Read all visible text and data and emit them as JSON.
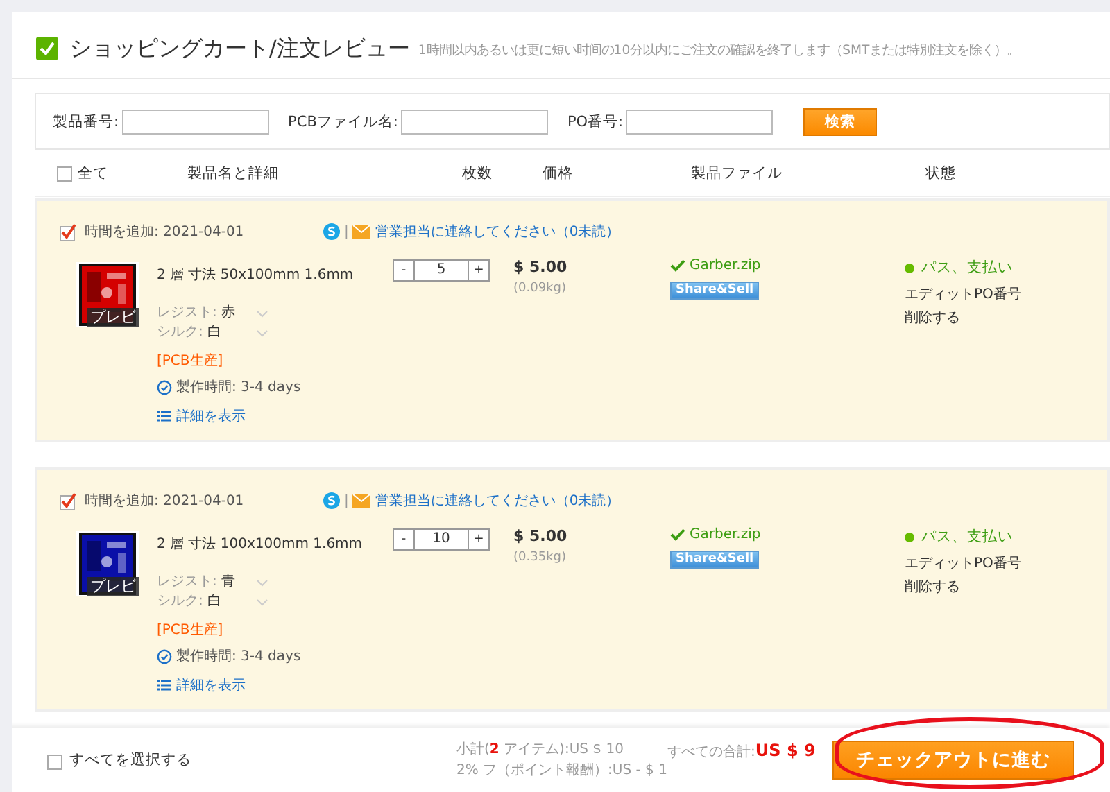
{
  "header": {
    "title": "ショッピングカート/注文レビュー",
    "note": "1時間以内あるいは更に短い时间の10分以内にご注文の確認を終了します（SMTまたは特別注文を除く）。"
  },
  "search": {
    "fields": [
      {
        "label": "製品番号:"
      },
      {
        "label": "PCBファイル名:"
      },
      {
        "label": "PO番号:"
      }
    ],
    "button": "検索"
  },
  "table": {
    "select_all": {
      "label": "全て",
      "checked": false
    },
    "columns": [
      "製品名と詳細",
      "枚数",
      "価格",
      "製品ファイル",
      "状態"
    ]
  },
  "items": [
    {
      "checked": true,
      "added": "時間を追加: 2021-04-01",
      "separator": "|",
      "contact": "営業担当に連絡してください（0未読）",
      "thumbnail": {
        "kind": "picture",
        "color": "#d40000"
      },
      "preview": "プレビ",
      "spec": "2 層 寸法 50x100mm 1.6mm",
      "options": [
        {
          "label": "レジスト:",
          "value": "赤"
        },
        {
          "label": "シルク:",
          "value": "白"
        }
      ],
      "tag": "[PCB生産]",
      "lead_time": "製作時間: 3-4 days",
      "details": "詳細を表示",
      "minus": "-",
      "quantity": "5",
      "plus": "+",
      "price": "$ 5.00",
      "weight": "(0.09kg)",
      "file": "Garber.zip",
      "share": "Share&Sell",
      "status": "パス、支払い",
      "actions": [
        "エディットPO番号",
        "削除する"
      ]
    },
    {
      "checked": true,
      "added": "時間を追加: 2021-04-01",
      "separator": "|",
      "contact": "営業担当に連絡してください（0未読）",
      "thumbnail": {
        "kind": "picture",
        "color": "#0a0fa8"
      },
      "preview": "プレビ",
      "spec": "2 層 寸法 100x100mm 1.6mm",
      "options": [
        {
          "label": "レジスト:",
          "value": "青"
        },
        {
          "label": "シルク:",
          "value": "白"
        }
      ],
      "tag": "[PCB生産]",
      "lead_time": "製作時間: 3-4 days",
      "details": "詳細を表示",
      "minus": "-",
      "quantity": "10",
      "plus": "+",
      "price": "$ 5.00",
      "weight": "(0.35kg)",
      "file": "Garber.zip",
      "share": "Share&Sell",
      "status": "パス、支払い",
      "actions": [
        "エディットPO番号",
        "削除する"
      ]
    }
  ],
  "footer": {
    "select_all": {
      "label": "すべてを選択する",
      "checked": false
    },
    "subtotal": "小計(**2** アイテム):US $ 10",
    "points": "2% フ（ポイント報酬）:US - $ 1",
    "total_label": "すべての合計:",
    "total": "US $ 9",
    "checkout": "チェックアウトに進む",
    "highlighted": true
  }
}
